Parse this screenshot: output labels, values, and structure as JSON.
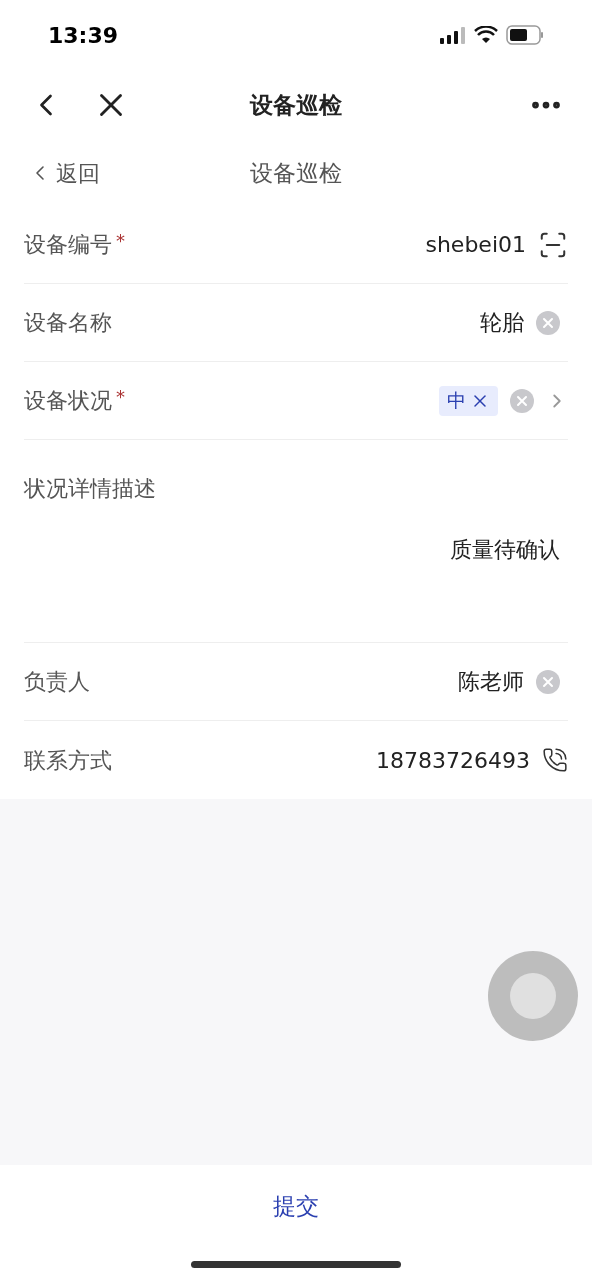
{
  "status_bar": {
    "time": "13:39"
  },
  "nav": {
    "title": "设备巡检"
  },
  "subheader": {
    "back": "返回",
    "title": "设备巡检"
  },
  "fields": [
    {
      "kind": "scan",
      "label": "设备编号",
      "required_mark": "*",
      "value": "shebei01"
    },
    {
      "kind": "clear",
      "label": "设备名称",
      "value": "轮胎"
    },
    {
      "kind": "tags",
      "label": "设备状况",
      "required_mark": "*",
      "tags": [
        "中"
      ]
    },
    {
      "kind": "textarea",
      "label": "状况详情描述",
      "value": "质量待确认"
    },
    {
      "kind": "clear",
      "label": "负责人",
      "value": "陈老师"
    },
    {
      "kind": "phone",
      "label": "联系方式",
      "value": "18783726493"
    }
  ],
  "submit": "提交"
}
